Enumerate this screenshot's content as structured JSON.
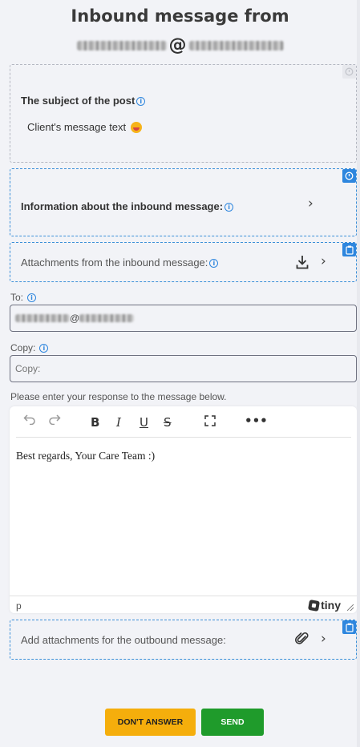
{
  "header": {
    "title": "Inbound message from",
    "sender_at": "@"
  },
  "subject_section": {
    "label": "The subject of the post",
    "text": "Client's message text"
  },
  "info_section": {
    "label": "Information about the inbound message:"
  },
  "attachments_section": {
    "label": "Attachments from the inbound message:"
  },
  "to_field": {
    "label": "To:",
    "value_at": "@"
  },
  "copy_field": {
    "label": "Copy:",
    "placeholder": "Copy:"
  },
  "response_prompt": "Please enter your response to the message below.",
  "editor": {
    "content": "Best regards, Your Care Team :)",
    "status_path": "p",
    "brand": "tiny"
  },
  "outbound_attachments": {
    "label": "Add attachments for the outbound message:"
  },
  "buttons": {
    "dont_answer": "DON'T ANSWER",
    "send": "SEND"
  },
  "colors": {
    "accent_blue": "#2e86de",
    "dont_answer_bg": "#f5ae0c",
    "send_bg": "#1f9b2b"
  }
}
